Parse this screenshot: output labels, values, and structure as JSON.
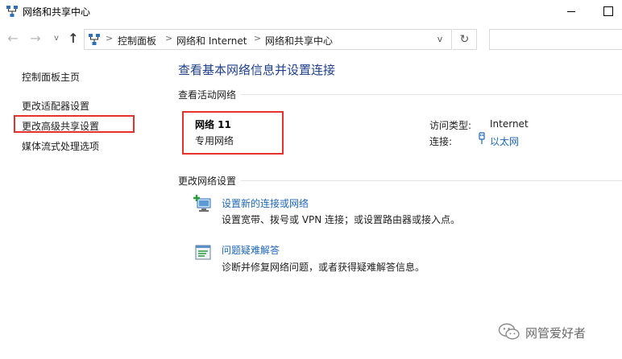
{
  "window": {
    "title": "网络和共享中心"
  },
  "address_bar": {
    "breadcrumbs": [
      "控制面板",
      "网络和 Internet",
      "网络和共享中心"
    ],
    "separator": ">"
  },
  "nav_glyphs": {
    "back": "←",
    "forward": "→",
    "recent": "v",
    "up": "↑",
    "dropdown": "v",
    "refresh": "↻"
  },
  "left_pane": {
    "home": "控制面板主页",
    "links": [
      "更改适配器设置",
      "更改高级共享设置",
      "媒体流式处理选项"
    ]
  },
  "main": {
    "title": "查看基本网络信息并设置连接",
    "active_networks_label": "查看活动网络",
    "network": {
      "name": "网络 11",
      "type": "专用网络",
      "access_type_label": "访问类型:",
      "access_type_value": "Internet",
      "connections_label": "连接:",
      "connections_value": "以太网"
    },
    "change_settings_label": "更改网络设置",
    "tasks": [
      {
        "title": "设置新的连接或网络",
        "desc": "设置宽带、拨号或 VPN 连接；或设置路由器或接入点。",
        "icon": "new-connection-icon"
      },
      {
        "title": "问题疑难解答",
        "desc": "诊断并修复网络问题，或者获得疑难解答信息。",
        "icon": "troubleshoot-icon"
      }
    ]
  },
  "watermark": {
    "text": "网管爱好者"
  },
  "colors": {
    "highlight_box": "#e5322d",
    "heading_blue": "#1e3f8c",
    "link_blue": "#1e66b8"
  }
}
